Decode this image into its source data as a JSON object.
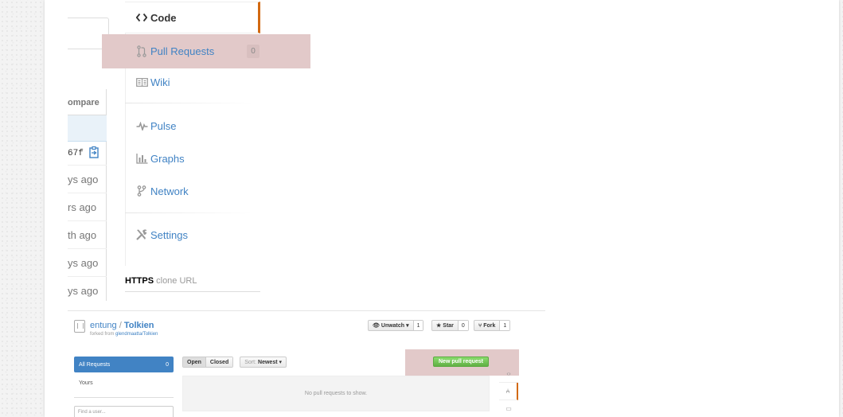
{
  "left_panel": {
    "compare_label": "ompare",
    "sha_fragment": "67f",
    "ages": [
      "ys ago",
      "rs ago",
      "th ago",
      "ys ago",
      "ys ago"
    ]
  },
  "menu": {
    "code": "Code",
    "pull_requests": "Pull Requests",
    "pull_requests_count": "0",
    "wiki": "Wiki",
    "pulse": "Pulse",
    "graphs": "Graphs",
    "network": "Network",
    "settings": "Settings"
  },
  "clone": {
    "protocol": "HTTPS",
    "suffix": " clone URL"
  },
  "mini": {
    "owner": "entung",
    "slash": " / ",
    "repo": "Tolkien",
    "forked_prefix": "forked from ",
    "forked_source": "glendmaatta/Tolkien",
    "unwatch": "Unwatch",
    "unwatch_count": "1",
    "star": "Star",
    "star_count": "0",
    "fork": "Fork",
    "fork_count": "1",
    "all_requests": "All Requests",
    "all_requests_count": "0",
    "yours": "Yours",
    "find_user_placeholder": "Find a user...",
    "tab_open": "Open",
    "tab_closed": "Closed",
    "sort_label": "Sort:",
    "sort_value": "Newest",
    "new_pr": "New pull request",
    "empty_message": "No pull requests to show."
  },
  "colors": {
    "accent": "#4183c4",
    "selected_bar": "#d26911",
    "highlight": "#e2c9c9",
    "green": "#60b044"
  }
}
